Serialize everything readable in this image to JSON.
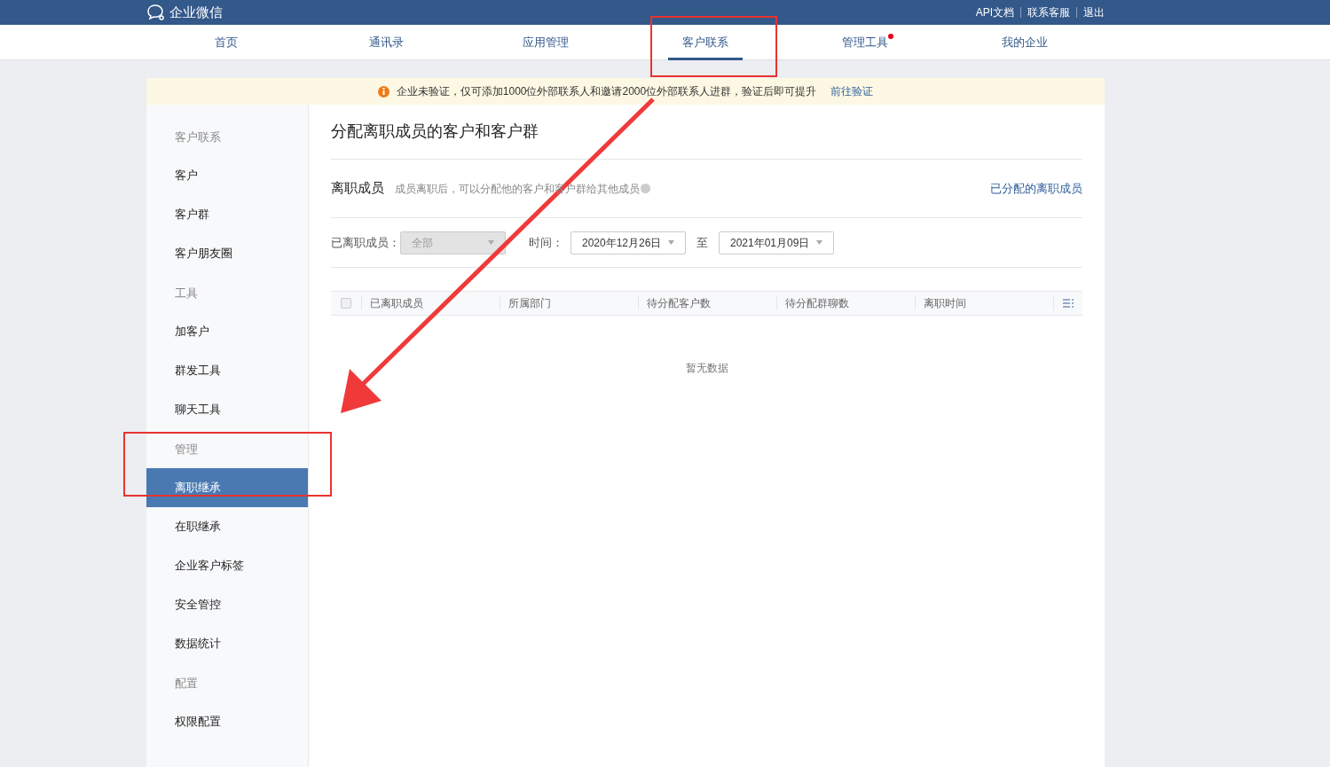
{
  "header": {
    "logo_text": "企业微信",
    "links": [
      "API文档",
      "联系客服",
      "退出"
    ]
  },
  "nav": [
    {
      "label": "首页",
      "selected": false,
      "dot": false
    },
    {
      "label": "通讯录",
      "selected": false,
      "dot": false
    },
    {
      "label": "应用管理",
      "selected": false,
      "dot": false
    },
    {
      "label": "客户联系",
      "selected": true,
      "dot": false
    },
    {
      "label": "管理工具",
      "selected": false,
      "dot": true
    },
    {
      "label": "我的企业",
      "selected": false,
      "dot": false
    }
  ],
  "notice": {
    "text": "企业未验证，仅可添加1000位外部联系人和邀请2000位外部联系人进群，验证后即可提升",
    "link": "前往验证"
  },
  "sidebar": [
    {
      "kind": "group",
      "label": "客户联系"
    },
    {
      "kind": "item",
      "label": "客户",
      "selected": false
    },
    {
      "kind": "item",
      "label": "客户群",
      "selected": false
    },
    {
      "kind": "item",
      "label": "客户朋友圈",
      "selected": false
    },
    {
      "kind": "group",
      "label": "工具"
    },
    {
      "kind": "item",
      "label": "加客户",
      "selected": false
    },
    {
      "kind": "item",
      "label": "群发工具",
      "selected": false
    },
    {
      "kind": "item",
      "label": "聊天工具",
      "selected": false
    },
    {
      "kind": "group",
      "label": "管理"
    },
    {
      "kind": "item",
      "label": "离职继承",
      "selected": true
    },
    {
      "kind": "item",
      "label": "在职继承",
      "selected": false
    },
    {
      "kind": "item",
      "label": "企业客户标签",
      "selected": false
    },
    {
      "kind": "item",
      "label": "安全管控",
      "selected": false
    },
    {
      "kind": "item",
      "label": "数据统计",
      "selected": false
    },
    {
      "kind": "group",
      "label": "配置"
    },
    {
      "kind": "item",
      "label": "权限配置",
      "selected": false
    }
  ],
  "main": {
    "title": "分配离职成员的客户和客户群",
    "section_title": "离职成员",
    "section_hint": "成员离职后，可以分配他的客户和客户群给其他成员",
    "section_link": "已分配的离职成员",
    "filters": {
      "member_label": "已离职成员：",
      "member_value": "全部",
      "member_disabled": true,
      "time_label": "时间：",
      "start": "2020年12月26日",
      "separator": "至",
      "end": "2021年01月09日"
    },
    "table": {
      "select_all_checked": false,
      "columns": [
        "已离职成员",
        "所属部门",
        "待分配客户数",
        "待分配群聊数",
        "离职时间"
      ],
      "empty_text": "暂无数据"
    }
  }
}
